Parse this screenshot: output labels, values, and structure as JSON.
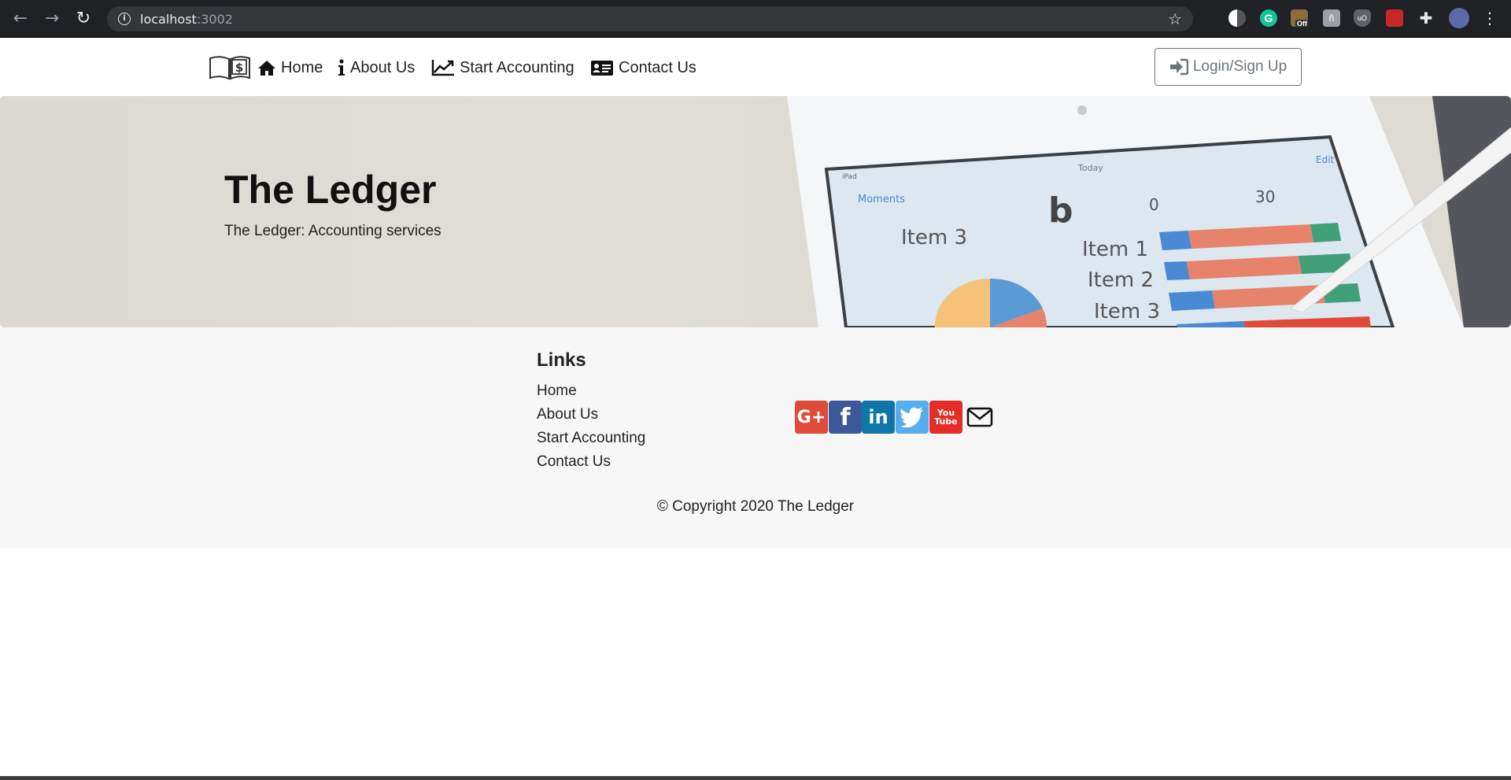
{
  "browser": {
    "url_host": "localhost",
    "url_port": ":3002"
  },
  "navbar": {
    "home_label": "Home",
    "about_label": "About Us",
    "accounting_label": "Start Accounting",
    "contact_label": "Contact Us",
    "login_label": "Login/Sign Up"
  },
  "hero": {
    "title": "The Ledger",
    "subtitle": "The Ledger: Accounting services",
    "photo_text": {
      "item3_left": "Item 3",
      "b": "b",
      "zero": "0",
      "thirty": "30",
      "item1": "Item 1",
      "item2": "Item 2",
      "item3": "Item 3",
      "moments": "Moments",
      "today": "Today",
      "edit": "Edit",
      "ipad": "iPad"
    }
  },
  "footer": {
    "links_title": "Links",
    "links": [
      "Home",
      "About Us",
      "Start Accounting",
      "Contact Us"
    ],
    "social_google": "G+",
    "social_facebook": "f",
    "social_linkedin": "in",
    "social_youtube_top": "You",
    "social_youtube_bottom": "Tube",
    "copyright": "© Copyright 2020 The Ledger"
  },
  "colors": {
    "google": "#dd4b39",
    "facebook": "#3b5998",
    "linkedin": "#0e76a8",
    "twitter": "#55acee",
    "youtube": "#e52d27",
    "footer_bg": "#f7f7f7"
  },
  "icons": {
    "brand": "book-dollar-icon",
    "home": "home-icon",
    "about": "info-icon",
    "accounting": "line-chart-icon",
    "contact": "id-card-icon",
    "login": "sign-in-icon",
    "mail": "envelope-icon"
  }
}
